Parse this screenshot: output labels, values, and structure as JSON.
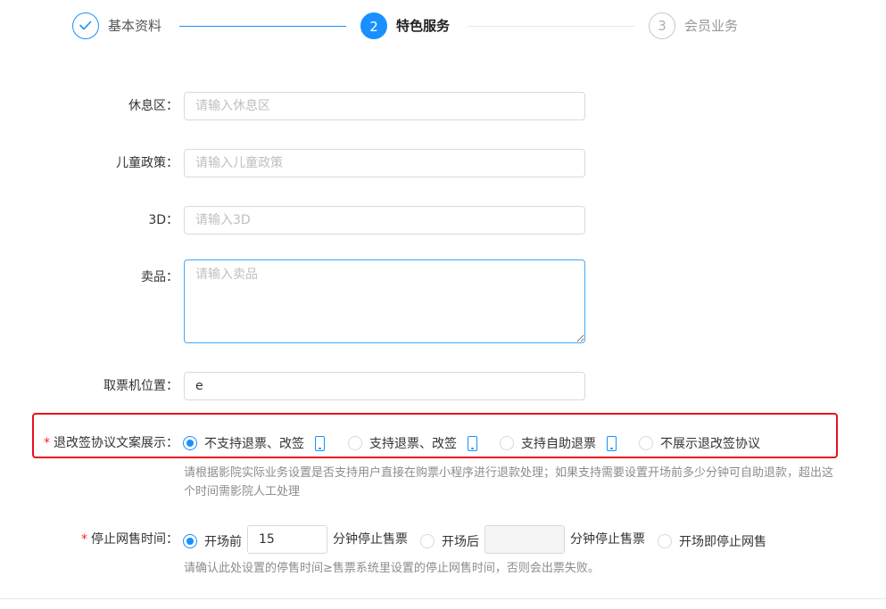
{
  "steps": [
    {
      "number": "",
      "title": "基本资料",
      "state": "done"
    },
    {
      "number": "2",
      "title": "特色服务",
      "state": "active"
    },
    {
      "number": "3",
      "title": "会员业务",
      "state": "todo"
    }
  ],
  "form": {
    "rest_area": {
      "label": "休息区",
      "placeholder": "请输入休息区",
      "value": ""
    },
    "child_policy": {
      "label": "儿童政策",
      "placeholder": "请输入儿童政策",
      "value": ""
    },
    "three_d": {
      "label": "3D",
      "placeholder": "请输入3D",
      "value": ""
    },
    "snacks": {
      "label": "卖品",
      "placeholder": "请输入卖品",
      "value": ""
    },
    "ticket_machine": {
      "label": "取票机位置",
      "placeholder": "",
      "value": "e"
    },
    "refund_policy": {
      "required_mark": "*",
      "label": "退改签协议文案展示",
      "options": [
        "不支持退票、改签",
        "支持退票、改签",
        "支持自助退票",
        "不展示退改签协议"
      ],
      "selected_index": 0,
      "hint": "请根据影院实际业务设置是否支持用户直接在购票小程序进行退款处理；如果支持需要设置开场前多少分钟可自助退款，超出这个时间需影院人工处理"
    },
    "stop_sale": {
      "required_mark": "*",
      "label": "停止网售时间",
      "option_before": "开场前",
      "before_value": "15",
      "before_unit": "分钟停止售票",
      "option_after": "开场后",
      "after_value": "",
      "after_unit": "分钟停止售票",
      "option_immediate": "开场即停止网售",
      "selected": "before",
      "hint": "请确认此处设置的停售时间≥售票系统里设置的停止网售时间，否则会出票失败。"
    },
    "colon": "："
  },
  "colors": {
    "primary": "#1890ff",
    "highlight": "#e8111e",
    "required": "#f5222d"
  }
}
